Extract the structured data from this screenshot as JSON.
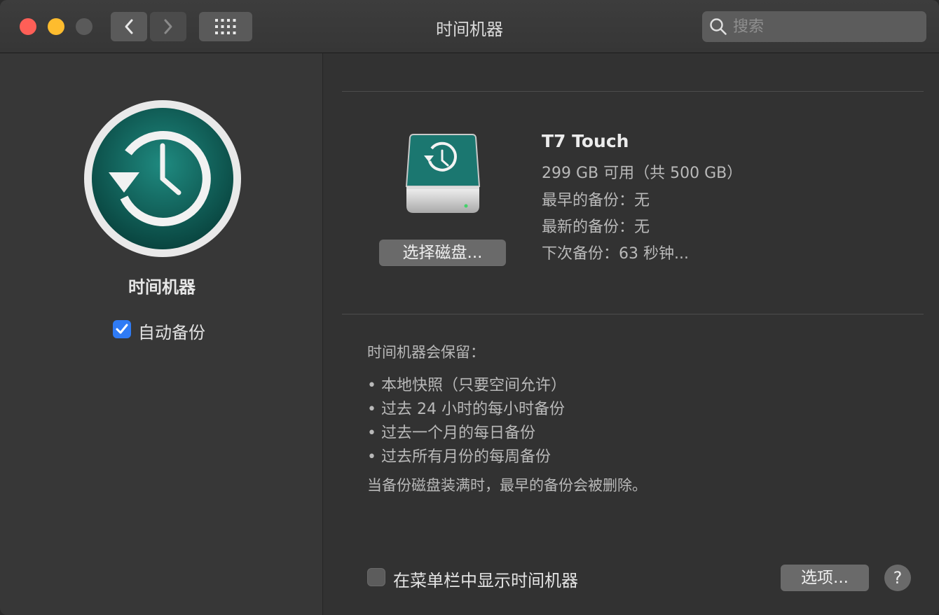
{
  "window": {
    "title": "时间机器"
  },
  "toolbar": {
    "search_placeholder": "搜索"
  },
  "sidebar": {
    "title": "时间机器",
    "auto_backup_label": "自动备份",
    "auto_backup_checked": true
  },
  "disk": {
    "select_button": "选择磁盘...",
    "name": "T7 Touch",
    "capacity": "299 GB 可用（共 500 GB）",
    "oldest_backup": "最早的备份：无",
    "latest_backup": "最新的备份：无",
    "next_backup": "下次备份：63 秒钟..."
  },
  "retention": {
    "title": "时间机器会保留：",
    "items": [
      "• 本地快照（只要空间允许）",
      "• 过去 24 小时的每小时备份",
      "• 过去一个月的每日备份",
      "• 过去所有月份的每周备份"
    ],
    "note": "当备份磁盘装满时，最早的备份会被删除。"
  },
  "footer": {
    "show_in_menubar_label": "在菜单栏中显示时间机器",
    "show_in_menubar_checked": false,
    "options_button": "选项...",
    "help_button": "?"
  },
  "colors": {
    "accent": "#2f7bf5",
    "tm_teal": "#0f6e66"
  }
}
